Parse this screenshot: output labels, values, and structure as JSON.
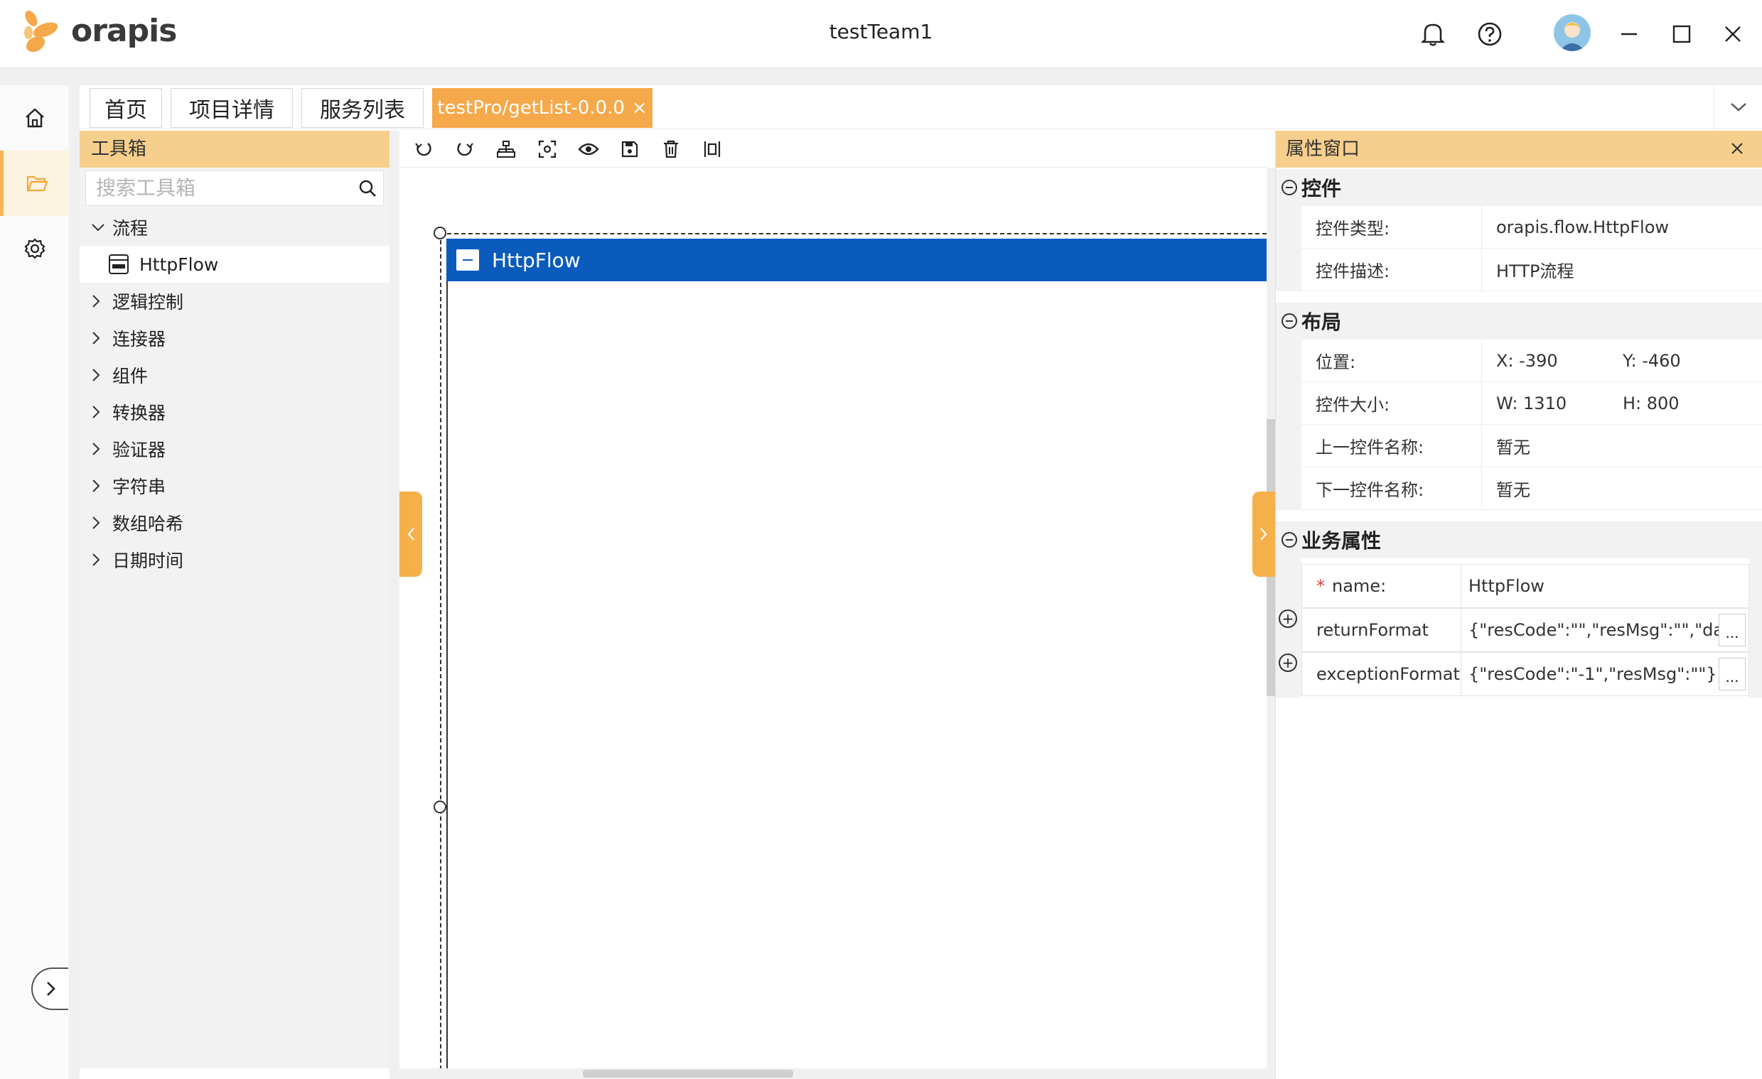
{
  "app": {
    "logo_text": "orapis",
    "window_title": "testTeam1"
  },
  "tabs": [
    {
      "label": "首页"
    },
    {
      "label": "项目详情"
    },
    {
      "label": "服务列表"
    },
    {
      "label": "testPro/getList-0.0.0",
      "close": "×"
    }
  ],
  "toolbox": {
    "title": "工具箱",
    "search_placeholder": "搜索工具箱",
    "tree": {
      "flow": "流程",
      "flow_child": "HttpFlow",
      "logic": "逻辑控制",
      "connector": "连接器",
      "component": "组件",
      "converter": "转换器",
      "validator": "验证器",
      "string": "字符串",
      "array_hash": "数组哈希",
      "datetime": "日期时间"
    }
  },
  "canvas": {
    "node_title": "HttpFlow"
  },
  "props": {
    "title": "属性窗口",
    "sections": {
      "control": "控件",
      "layout": "布局",
      "business": "业务属性"
    },
    "control": {
      "type_label": "控件类型:",
      "type_value": "orapis.flow.HttpFlow",
      "desc_label": "控件描述:",
      "desc_value": "HTTP流程"
    },
    "layout": {
      "pos_label": "位置:",
      "pos_x": "X: -390",
      "pos_y": "Y: -460",
      "size_label": "控件大小:",
      "size_w": "W: 1310",
      "size_h": "H: 800",
      "prev_label": "上一控件名称:",
      "prev_value": "暂无",
      "next_label": "下一控件名称:",
      "next_value": "暂无"
    },
    "business": {
      "required_mark": "*",
      "name_label": "name:",
      "name_value": "HttpFlow",
      "return_label": "returnFormat",
      "return_value": "{\"resCode\":\"\",\"resMsg\":\"\",\"data\":...",
      "exception_label": "exceptionFormat",
      "exception_value": "{\"resCode\":\"-1\",\"resMsg\":\"\"}",
      "more": "...",
      "expand": "+"
    }
  },
  "colors": {
    "accent": "#f5a94a",
    "header": "#f7cf8d",
    "node": "#0b5bbd"
  }
}
